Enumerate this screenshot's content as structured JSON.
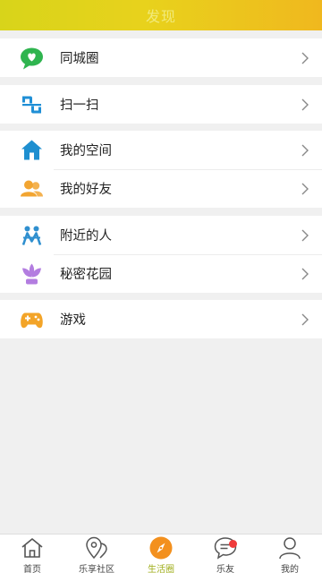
{
  "header": {
    "title": "发现"
  },
  "groups": [
    {
      "items": [
        {
          "label": "同城圈",
          "icon": "chat-bubble-heart-icon",
          "color": "#2fb44f"
        }
      ]
    },
    {
      "items": [
        {
          "label": "扫一扫",
          "icon": "scan-icon",
          "color": "#1f8fd6"
        }
      ]
    },
    {
      "items": [
        {
          "label": "我的空间",
          "icon": "home-icon",
          "color": "#1e8fd0"
        },
        {
          "label": "我的好友",
          "icon": "friends-icon",
          "color": "#f2a531"
        }
      ]
    },
    {
      "items": [
        {
          "label": "附近的人",
          "icon": "nearby-people-icon",
          "color": "#2f8fcf"
        },
        {
          "label": "秘密花园",
          "icon": "flower-icon",
          "color": "#b37de0"
        }
      ]
    },
    {
      "items": [
        {
          "label": "游戏",
          "icon": "gamepad-icon",
          "color": "#f3a428"
        }
      ]
    }
  ],
  "tabbar": {
    "tabs": [
      {
        "label": "首页",
        "icon": "home-outline-icon"
      },
      {
        "label": "乐享社区",
        "icon": "location-pin-icon"
      },
      {
        "label": "生活圈",
        "icon": "compass-icon",
        "active": true
      },
      {
        "label": "乐友",
        "icon": "message-icon",
        "badge": true
      },
      {
        "label": "我的",
        "icon": "user-icon"
      }
    ]
  },
  "colors": {
    "accent": "#e8c51d",
    "active_tab": "#9fae1b",
    "compass_bg": "#f3901e",
    "badge": "#ef3b3b"
  }
}
